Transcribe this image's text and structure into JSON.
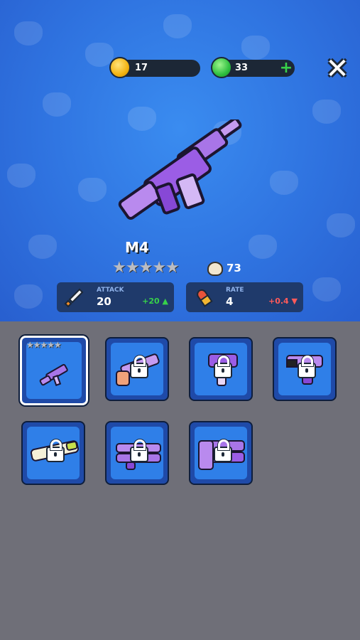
{
  "currency": {
    "coins": "17",
    "gems": "33"
  },
  "weapon": {
    "name": "M4",
    "stars": [
      "★",
      "★",
      "★",
      "★",
      "★"
    ],
    "kills": "73"
  },
  "stats": {
    "attack": {
      "label": "ATTACK",
      "value": "20",
      "delta": "+20"
    },
    "rate": {
      "label": "RATE",
      "value": "4",
      "delta": "+0.4"
    }
  },
  "inventory": [
    {
      "name": "M4",
      "locked": false,
      "selected": true,
      "stars": "★★★★★"
    },
    {
      "name": "shotgun",
      "locked": true
    },
    {
      "name": "uzi",
      "locked": true
    },
    {
      "name": "pistol",
      "locked": true
    },
    {
      "name": "rocket-launcher",
      "locked": true
    },
    {
      "name": "minigun",
      "locked": true
    },
    {
      "name": "heavy-minigun",
      "locked": true
    }
  ],
  "colors": {
    "accent": "#2f73e0",
    "panel": "#1f3a6b",
    "positive": "#37d14a",
    "negative": "#e23b3b",
    "weapon": "#9b5de5"
  }
}
